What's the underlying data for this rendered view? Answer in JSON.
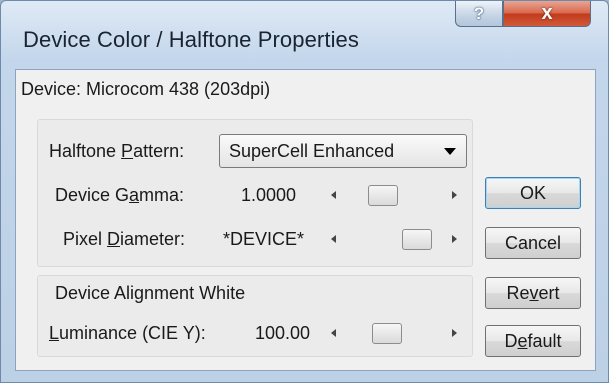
{
  "window": {
    "title": "Device Color / Halftone Properties",
    "help_glyph": "?",
    "close_glyph": "x"
  },
  "device": {
    "text": "Device: Microcom 438 (203dpi)"
  },
  "halftone": {
    "pattern_label_pre": "Halftone ",
    "pattern_label_u": "P",
    "pattern_label_post": "attern:",
    "pattern_value": "SuperCell Enhanced",
    "gamma_label_pre": "Device G",
    "gamma_label_u": "a",
    "gamma_label_post": "mma:",
    "gamma_value": "1.0000",
    "pixel_label_pre": "Pixel ",
    "pixel_label_u": "D",
    "pixel_label_post": "iameter:",
    "pixel_value": "*DEVICE*"
  },
  "alignment": {
    "group_label": "Device Alignment White",
    "lum_label_u": "L",
    "lum_label_post": "uminance (CIE Y):",
    "lum_value": "100.00"
  },
  "sliders": {
    "gamma_fraction": 0.35,
    "pixel_fraction": 0.82,
    "luminance_fraction": 0.4
  },
  "buttons": {
    "ok": "OK",
    "cancel": "Cancel",
    "revert_pre": "Re",
    "revert_u": "v",
    "revert_post": "ert",
    "default_pre": "D",
    "default_u": "e",
    "default_post": "fault"
  }
}
